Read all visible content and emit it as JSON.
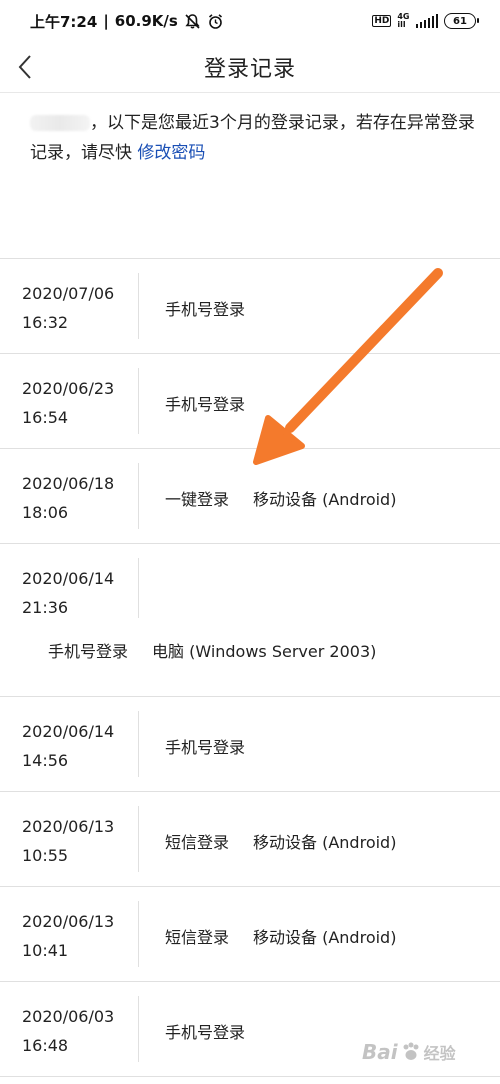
{
  "status_bar": {
    "time": "上午7:24",
    "speed": "60.9K/s",
    "hd": "HD",
    "network_top": "4G",
    "network_bottom": "ill",
    "battery": "61"
  },
  "header": {
    "title": "登录记录",
    "back_icon": "chevron-left-icon"
  },
  "intro": {
    "text_before": "，以下是您最近3个月的登录记录，若存在异常登录记录，请尽快",
    "link": "修改密码"
  },
  "records": [
    {
      "date": "2020/07/06",
      "time": "16:32",
      "method": "手机号登录",
      "device": ""
    },
    {
      "date": "2020/06/23",
      "time": "16:54",
      "method": "手机号登录",
      "device": ""
    },
    {
      "date": "2020/06/18",
      "time": "18:06",
      "method": "一键登录",
      "device": "移动设备 (Android)"
    },
    {
      "date": "2020/06/14",
      "time": "21:36",
      "method": "手机号登录",
      "device": "电脑 (Windows Server 2003)"
    },
    {
      "date": "2020/06/14",
      "time": "14:56",
      "method": "手机号登录",
      "device": ""
    },
    {
      "date": "2020/06/13",
      "time": "10:55",
      "method": "短信登录",
      "device": "移动设备 (Android)"
    },
    {
      "date": "2020/06/13",
      "time": "10:41",
      "method": "短信登录",
      "device": "移动设备 (Android)"
    },
    {
      "date": "2020/06/03",
      "time": "16:48",
      "method": "手机号登录",
      "device": ""
    }
  ],
  "colors": {
    "link": "#1a4fb5",
    "arrow": "#f47a2c",
    "divider": "#e0e0e0"
  },
  "watermark": {
    "text": "Bai",
    "suffix": "经验"
  }
}
